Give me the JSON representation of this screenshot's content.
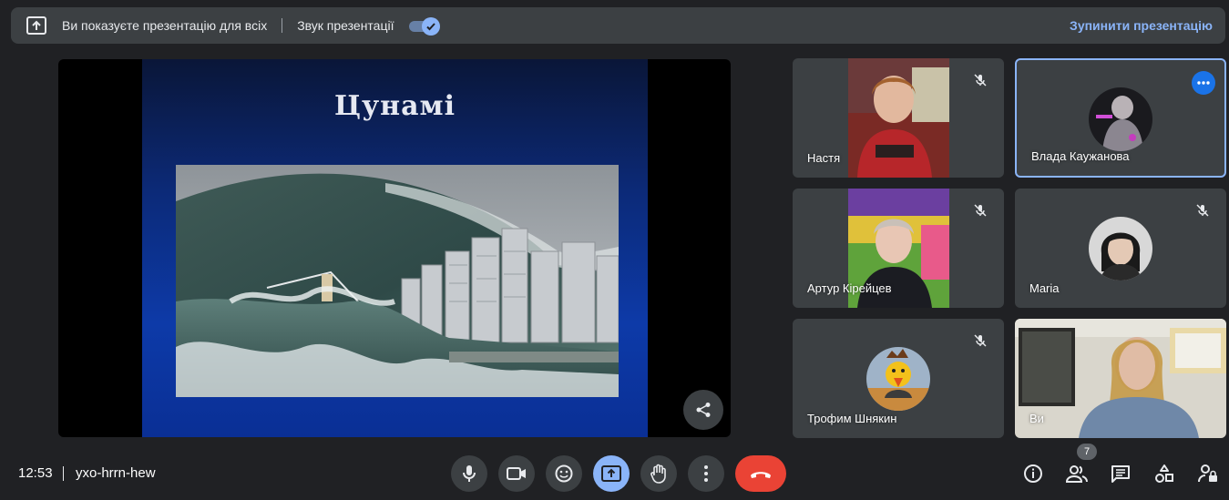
{
  "banner": {
    "presenting_text": "Ви показуєте презентацію для всіх",
    "sound_label": "Звук презентації",
    "sound_enabled": true,
    "stop_label": "Зупинити презентацію"
  },
  "slide": {
    "title": "Цунамі"
  },
  "participants": [
    {
      "name": "Настя",
      "muted": true,
      "mode": "video"
    },
    {
      "name": "Влада Каужанова",
      "muted": false,
      "mode": "avatar",
      "active_speaker": true
    },
    {
      "name": "Артур Кірейцев",
      "muted": true,
      "mode": "video"
    },
    {
      "name": "Maria",
      "muted": true,
      "mode": "avatar"
    },
    {
      "name": "Трофим Шнякин",
      "muted": true,
      "mode": "avatar"
    },
    {
      "name": "Ви",
      "muted": false,
      "mode": "video"
    }
  ],
  "bottom": {
    "time": "12:53",
    "meeting_code": "yxo-hrrn-hew",
    "participants_count": "7"
  },
  "colors": {
    "accent": "#8ab4f8",
    "end_call": "#ea4335",
    "tile_bg": "#3c4043",
    "page_bg": "#202124"
  }
}
